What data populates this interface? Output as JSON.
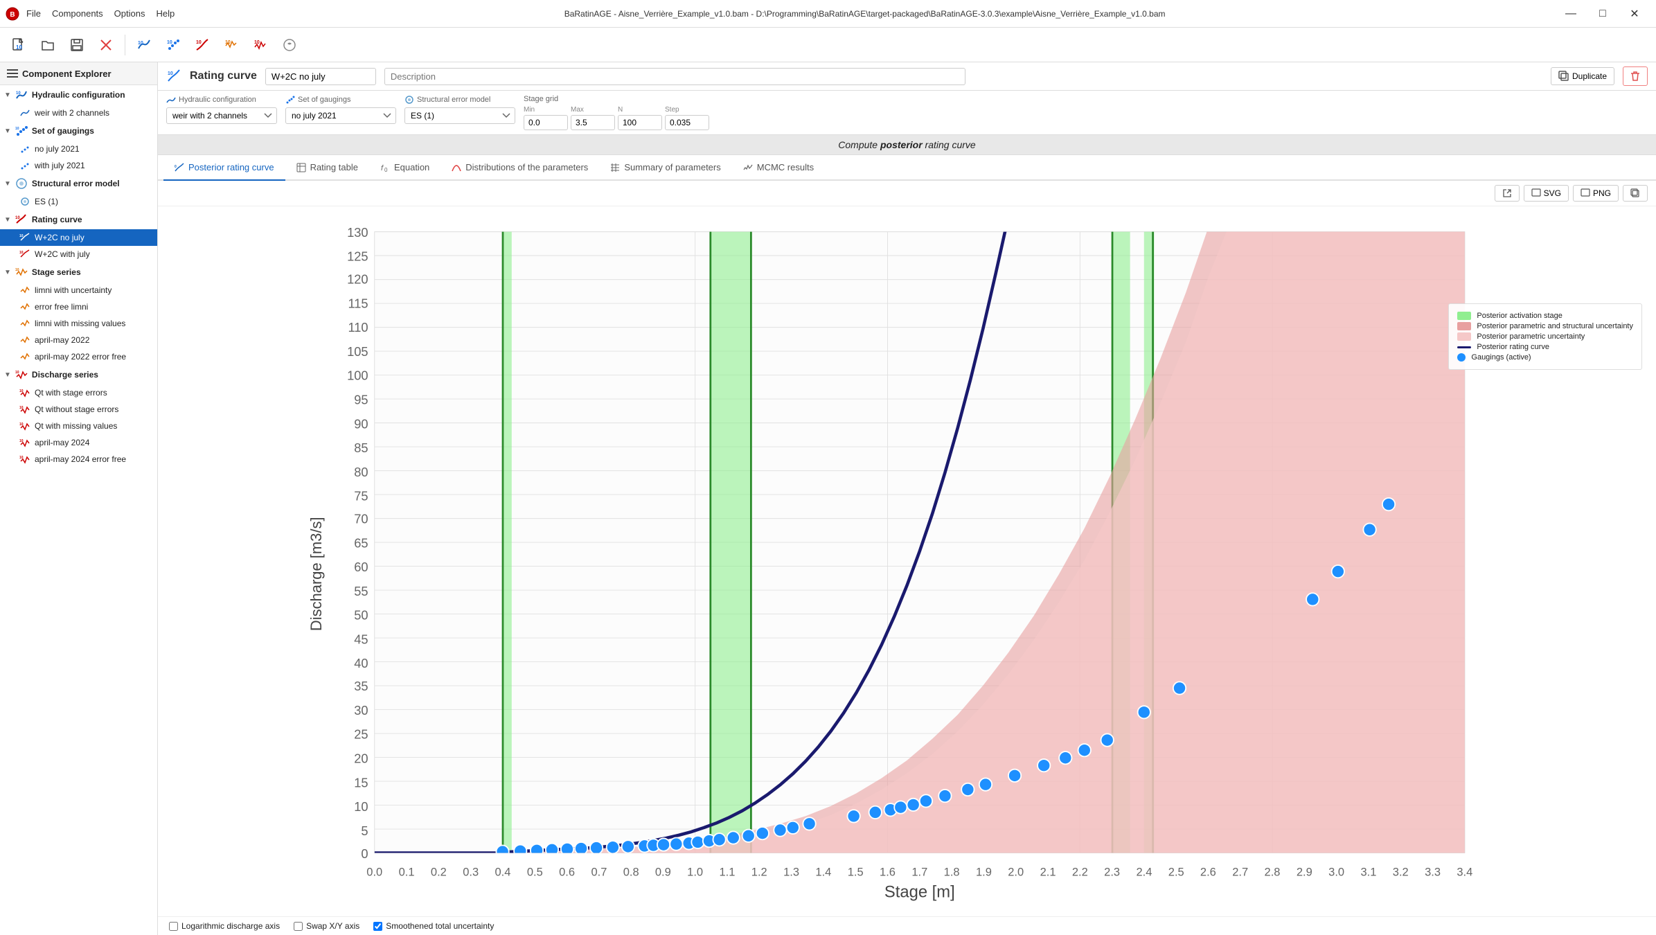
{
  "titlebar": {
    "app_name": "BaRatinAGE",
    "file_name": "Aisne_Verrière_Example_v1.0.bam",
    "file_path": "D:\\Programming\\BaRatinAGE\\target-packaged\\BaRatinAGE-3.0.3\\example\\Aisne_Verrière_Example_v1.0.bam",
    "menus": [
      "File",
      "Components",
      "Options",
      "Help"
    ],
    "win_controls": [
      "—",
      "□",
      "✕"
    ]
  },
  "sidebar": {
    "header": "Component Explorer",
    "sections": [
      {
        "label": "Hydraulic configuration",
        "id": "hydraulic-config",
        "items": [
          "weir with 2 channels"
        ]
      },
      {
        "label": "Set of gaugings",
        "id": "set-of-gaugings",
        "items": [
          "no july 2021",
          "with july 2021"
        ]
      },
      {
        "label": "Structural error model",
        "id": "structural-error",
        "items": [
          "ES (1)"
        ]
      },
      {
        "label": "Rating curve",
        "id": "rating-curve",
        "items": [
          "W+2C no july",
          "W+2C with july"
        ],
        "active_item": "W+2C no july"
      },
      {
        "label": "Stage series",
        "id": "stage-series",
        "items": [
          "limni with uncertainty",
          "error free limni",
          "limni with missing values",
          "april-may 2022",
          "april-may 2022 error free"
        ]
      },
      {
        "label": "Discharge series",
        "id": "discharge-series",
        "items": [
          "Qt with stage errors",
          "Qt without stage errors",
          "Qt with missing values",
          "april-may 2024",
          "april-may 2024 error free"
        ]
      }
    ]
  },
  "rating_curve": {
    "title": "Rating curve",
    "name_value": "W+2C no july",
    "description_placeholder": "Description",
    "duplicate_label": "Duplicate",
    "delete_label": "🗑"
  },
  "config": {
    "hydraulic_label": "Hydraulic configuration",
    "hydraulic_value": "weir with 2 channels",
    "gaugings_label": "Set of gaugings",
    "gaugings_value": "no july 2021",
    "structural_label": "Structural error model",
    "structural_value": "ES (1)",
    "stage_grid_label": "Stage grid",
    "min_label": "Min",
    "min_value": "0.0",
    "max_label": "Max",
    "max_value": "3.5",
    "n_label": "N",
    "n_value": "100",
    "step_label": "Step",
    "step_value": "0.035"
  },
  "compute_row": {
    "text_before": "Compute ",
    "italic_bold": "posterior",
    "text_after": " rating curve"
  },
  "tabs": [
    {
      "id": "posterior-rc",
      "label": "Posterior rating curve",
      "active": true
    },
    {
      "id": "rating-table",
      "label": "Rating table",
      "active": false
    },
    {
      "id": "equation",
      "label": "Equation",
      "active": false
    },
    {
      "id": "distributions",
      "label": "Distributions of the parameters",
      "active": false
    },
    {
      "id": "summary",
      "label": "Summary of parameters",
      "active": false
    },
    {
      "id": "mcmc",
      "label": "MCMC results",
      "active": false
    }
  ],
  "chart": {
    "y_label": "Discharge [m3/s]",
    "x_label": "Stage [m]",
    "y_ticks": [
      "130",
      "125",
      "120",
      "115",
      "110",
      "105",
      "100",
      "95",
      "90",
      "85",
      "80",
      "75",
      "70",
      "65",
      "60",
      "55",
      "50",
      "45",
      "40",
      "35",
      "30",
      "25",
      "20",
      "15",
      "10",
      "5",
      "0"
    ],
    "x_ticks": [
      "0.0",
      "0.1",
      "0.2",
      "0.3",
      "0.4",
      "0.5",
      "0.6",
      "0.7",
      "0.8",
      "0.9",
      "1.0",
      "1.1",
      "1.2",
      "1.3",
      "1.4",
      "1.5",
      "1.6",
      "1.7",
      "1.8",
      "1.9",
      "2.0",
      "2.1",
      "2.2",
      "2.3",
      "2.4",
      "2.5",
      "2.6",
      "2.7",
      "2.8",
      "2.9",
      "3.0",
      "3.1",
      "3.2",
      "3.3",
      "3.4"
    ]
  },
  "legend": {
    "items": [
      {
        "label": "Posterior activation stage",
        "type": "box",
        "color": "#90ee90"
      },
      {
        "label": "Posterior parametric and structural uncertainty",
        "type": "box",
        "color": "#e8a0a0"
      },
      {
        "label": "Posterior parametric uncertainty",
        "type": "box",
        "color": "#f5c8c8"
      },
      {
        "label": "Posterior rating curve",
        "type": "line",
        "color": "#1a1a6e"
      },
      {
        "label": "Gaugings (active)",
        "type": "dot",
        "color": "#1e90ff"
      }
    ]
  },
  "footer": {
    "logarithmic_label": "Logarithmic discharge axis",
    "logarithmic_checked": false,
    "swap_label": "Swap X/Y axis",
    "swap_checked": false,
    "smoothed_label": "Smoothened total uncertainty",
    "smoothed_checked": true
  },
  "chart_buttons": [
    {
      "label": "↗",
      "id": "open-external"
    },
    {
      "label": "SVG",
      "id": "save-svg"
    },
    {
      "label": "PNG",
      "id": "save-png"
    },
    {
      "label": "⧉",
      "id": "copy"
    }
  ]
}
